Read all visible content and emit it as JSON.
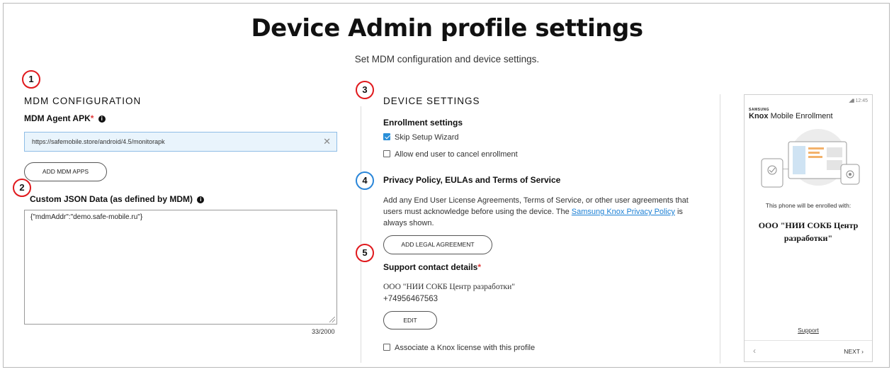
{
  "header": {
    "title": "Device Admin profile settings",
    "subtitle": "Set MDM configuration and device settings."
  },
  "markers": [
    "1",
    "2",
    "3",
    "4",
    "5"
  ],
  "mdm": {
    "section_title": "MDM CONFIGURATION",
    "apk_label": "MDM Agent APK",
    "required_mark": "*",
    "apk_value": "https://safemobile.store/android/4.5/monitorapk",
    "add_apps_button": "ADD MDM APPS",
    "json_label": "Custom JSON Data (as defined by MDM)",
    "json_value": "{\"mdmAddr\":\"demo.safe-mobile.ru\"}",
    "char_count": "33/2000"
  },
  "device": {
    "section_title": "DEVICE SETTINGS",
    "enrollment_label": "Enrollment settings",
    "skip_wizard": "Skip Setup Wizard",
    "allow_cancel": "Allow end user to cancel enrollment",
    "privacy_label": "Privacy Policy, EULAs and Terms of Service",
    "privacy_text_1": "Add any End User License Agreements, Terms of Service, or other user agreements that",
    "privacy_text_2": "users must acknowledge before using the device. The",
    "privacy_link": "Samsung Knox Privacy Policy",
    "privacy_text_3": "is",
    "privacy_text_4": "always shown.",
    "add_legal_button": "ADD LEGAL AGREEMENT",
    "support_label": "Support contact details",
    "support_name": "ООО \"НИИ СОКБ Центр разработки\"",
    "support_phone": "+74956467563",
    "edit_button": "EDIT",
    "associate_license": "Associate a Knox license with this profile"
  },
  "phone": {
    "status": "12:45",
    "brand_small": "SAMSUNG",
    "brand_knox": "Knox",
    "brand_rest": "Mobile Enrollment",
    "enrolled_with": "This phone will be enrolled with:",
    "org_line1": "ООО \"НИИ СОКБ Центр",
    "org_line2": "разработки\"",
    "support_link": "Support",
    "back": "‹",
    "next": "NEXT ›"
  }
}
